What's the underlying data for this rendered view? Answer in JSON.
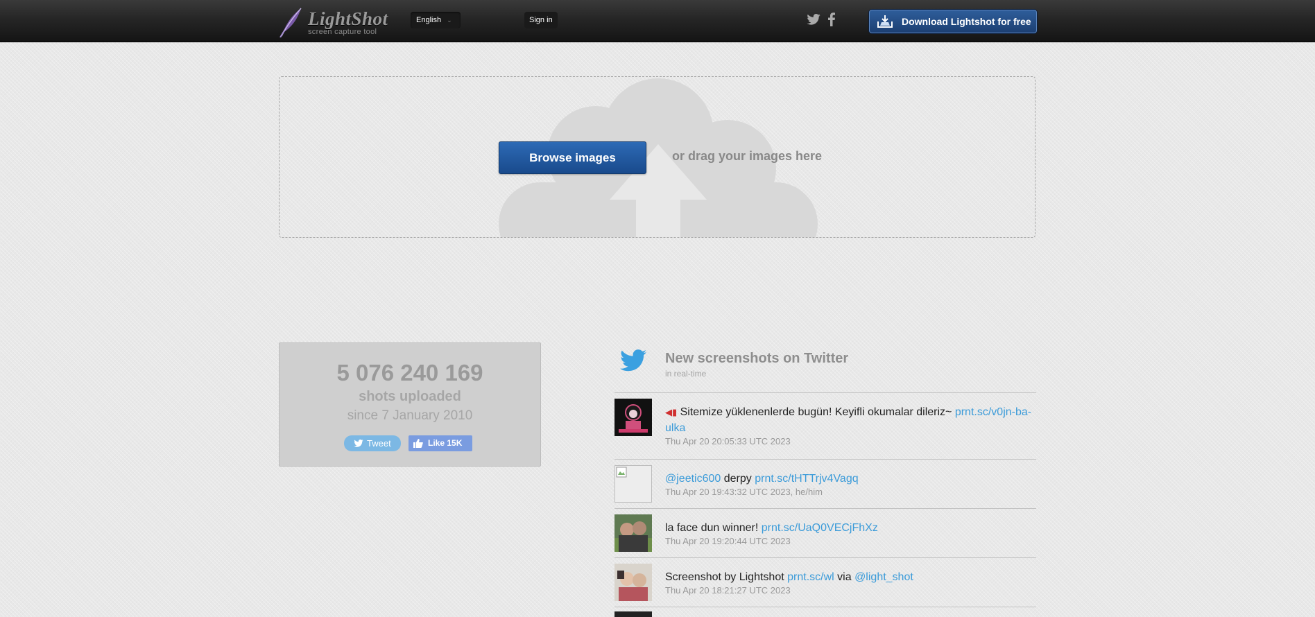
{
  "header": {
    "logo_text": "LightShot",
    "logo_subtitle": "screen capture tool",
    "language": "English",
    "signin_label": "Sign in",
    "download_label": "Download Lightshot for free"
  },
  "upload": {
    "browse_label": "Browse images",
    "drag_text": "or drag your images here"
  },
  "stats": {
    "count": "5 076 240 169",
    "label": "shots uploaded",
    "since": "since 7 January 2010",
    "tweet_label": "Tweet",
    "like_label": "Like",
    "like_count": "15K"
  },
  "feed": {
    "title": "New screenshots on Twitter",
    "subtitle": "in real-time",
    "tweets": [
      {
        "text": "Sitemize yüklenenlerde bugün! Keyifli okumalar dileriz~",
        "link": "prnt.sc/v0jn-ba-ulka",
        "meta": "Thu Apr 20 20:05:33 UTC 2023"
      },
      {
        "mention": "@jeetic600",
        "text": "derpy",
        "link": "prnt.sc/tHTTrjv4Vagq",
        "meta": "Thu Apr 20 19:43:32 UTC 2023, he/him"
      },
      {
        "text": "la face dun winner!",
        "link": "prnt.sc/UaQ0VECjFhXz",
        "meta": "Thu Apr 20 19:20:44 UTC 2023"
      },
      {
        "text": "Screenshot by Lightshot",
        "link": "prnt.sc/wl",
        "via": "via",
        "via_mention": "@light_shot",
        "meta": "Thu Apr 20 18:21:27 UTC 2023"
      }
    ]
  },
  "colors": {
    "link": "#3b9bd9",
    "browse_button": "#1f5399",
    "download_button": "#24487f",
    "twitter_blue": "#3ba0e0"
  },
  "icons": [
    "feather-logo-icon",
    "twitter-icon",
    "facebook-icon",
    "download-icon",
    "cloud-upload-icon",
    "thumbs-up-icon"
  ]
}
